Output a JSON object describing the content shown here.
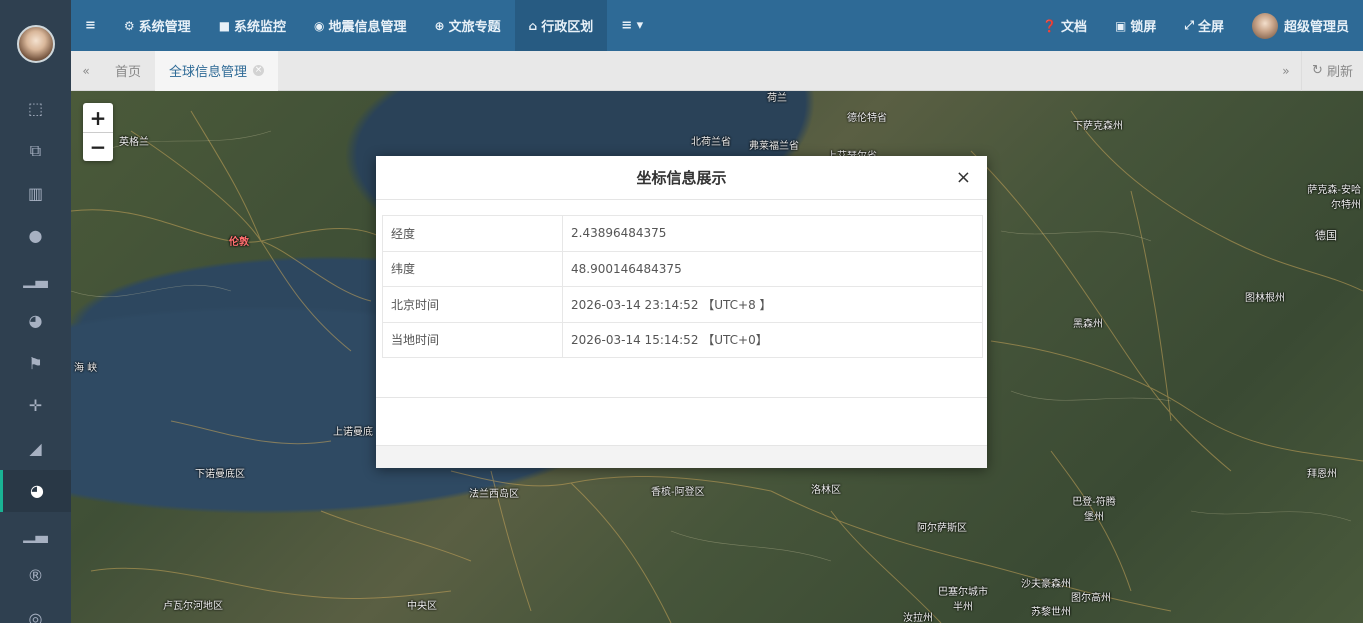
{
  "topnav": {
    "menu_icon": "bars-icon",
    "items": [
      {
        "icon": "gear-icon",
        "label": "系统管理"
      },
      {
        "icon": "camera-icon",
        "label": "系统监控"
      },
      {
        "icon": "location-icon",
        "label": "地震信息管理"
      },
      {
        "icon": "globe-icon",
        "label": "文旅专题"
      },
      {
        "icon": "bank-icon",
        "label": "行政区划"
      }
    ],
    "more_icon": "list-dropdown-icon",
    "right": {
      "docs": "文档",
      "lock": "锁屏",
      "fullscreen": "全屏",
      "user": "超级管理员"
    }
  },
  "tabs": {
    "items": [
      {
        "label": "首页"
      },
      {
        "label": "全球信息管理"
      }
    ],
    "refresh": "刷新"
  },
  "sidebar": {
    "icons": [
      "frame-icon",
      "frames-icon",
      "map-icon",
      "pin-icon",
      "bar-chart-icon",
      "globe-icon",
      "flag-icon",
      "move-icon",
      "area-chart-icon",
      "globe-active-icon",
      "bar-chart-icon-2",
      "registered-icon",
      "lifebuoy-icon"
    ]
  },
  "map": {
    "labels": [
      {
        "text": "英格兰"
      },
      {
        "text": "伦敦"
      },
      {
        "text": "海 峡"
      },
      {
        "text": "上诺曼底"
      },
      {
        "text": "下诺曼底区"
      },
      {
        "text": "法兰西岛区"
      },
      {
        "text": "香槟-阿登区"
      },
      {
        "text": "洛林区"
      },
      {
        "text": "阿尔萨斯区"
      },
      {
        "text": "卢瓦尔河地区"
      },
      {
        "text": "中央区"
      },
      {
        "text": "北荷兰省"
      },
      {
        "text": "弗莱福兰省"
      },
      {
        "text": "德伦特省"
      },
      {
        "text": "上艾瑟尔省"
      },
      {
        "text": "下萨克森州"
      },
      {
        "text": "萨克森-安哈尔特州"
      },
      {
        "text": "德国"
      },
      {
        "text": "图林根州"
      },
      {
        "text": "黑森州"
      },
      {
        "text": "巴登-符腾堡州"
      },
      {
        "text": "拜恩州"
      },
      {
        "text": "巴塞尔城市半州"
      },
      {
        "text": "汝拉州"
      },
      {
        "text": "沙夫豪森州"
      },
      {
        "text": "图尔高州"
      },
      {
        "text": "苏黎世州"
      },
      {
        "text": "荷兰"
      }
    ]
  },
  "modal": {
    "title": "坐标信息展示",
    "close": "×",
    "rows": [
      {
        "key": "经度",
        "value": "2.43896484375"
      },
      {
        "key": "纬度",
        "value": "48.900146484375"
      },
      {
        "key": "北京时间",
        "value": "2026-03-14 23:14:52 【UTC+8 】"
      },
      {
        "key": "当地时间",
        "value": "2026-03-14 15:14:52 【UTC+0】"
      }
    ]
  }
}
